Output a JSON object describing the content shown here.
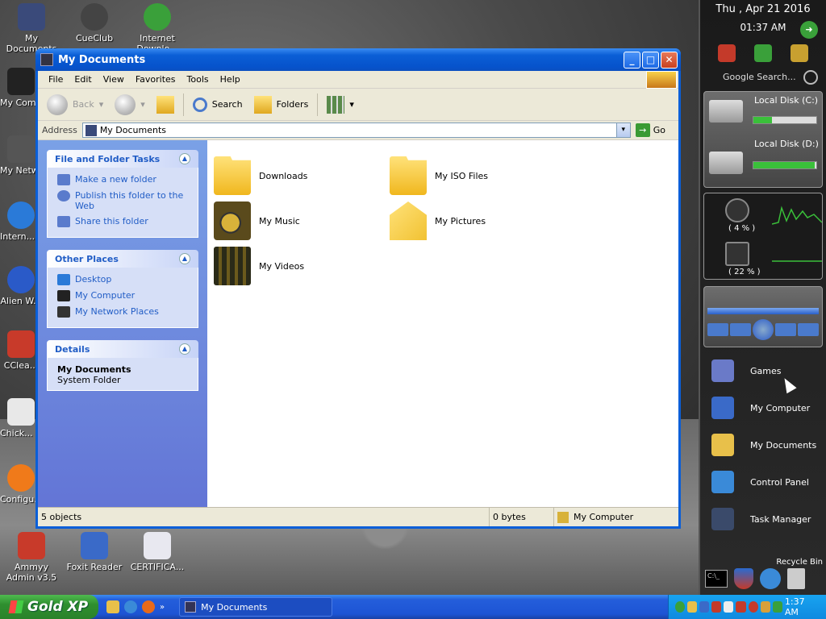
{
  "desktop": {
    "icons": [
      {
        "label": "My Documents",
        "color": "#3a4a7a"
      },
      {
        "label": "CueClub",
        "color": "#444444"
      },
      {
        "label": "Internet Downlo...",
        "color": "#3aa03a"
      },
      {
        "label": "My Com...",
        "color": "#222222"
      },
      {
        "label": "My Netw... Place...",
        "color": "#555555"
      },
      {
        "label": "Intern... Explo...",
        "color": "#2a7ad8"
      },
      {
        "label": "Alien W...",
        "color": "#2a5ac8"
      },
      {
        "label": "CClea...",
        "color": "#c83a2a"
      },
      {
        "label": "Chick... Invade...",
        "color": "#e8e8e8"
      },
      {
        "label": "Configu... Fire Scre...",
        "color": "#f07a1a"
      },
      {
        "label": "Ammyy Admin v3.5",
        "color": "#c83a2a"
      },
      {
        "label": "Foxit Reader",
        "color": "#3a6ac8"
      },
      {
        "label": "CERTIFICA...",
        "color": "#e8e8f0"
      }
    ]
  },
  "window": {
    "title": "My Documents",
    "controls": {
      "minimize": "_",
      "maximize": "□",
      "close": "✕"
    },
    "menu": [
      "File",
      "Edit",
      "View",
      "Favorites",
      "Tools",
      "Help"
    ],
    "toolbar": {
      "back": "Back",
      "search": "Search",
      "folders": "Folders"
    },
    "address": {
      "label": "Address",
      "value": "My Documents",
      "go": "Go",
      "go_arrow": "→",
      "dropdown": "▾"
    },
    "tasks_panel": {
      "title": "File and Folder Tasks",
      "items": [
        "Make a new folder",
        "Publish this folder to the Web",
        "Share this folder"
      ]
    },
    "places_panel": {
      "title": "Other Places",
      "items": [
        "Desktop",
        "My Computer",
        "My Network Places"
      ]
    },
    "details_panel": {
      "title": "Details",
      "name": "My Documents",
      "type": "System Folder"
    },
    "files": [
      {
        "name": "Downloads",
        "icon": "folder-icon"
      },
      {
        "name": "My ISO Files",
        "icon": "folder-icon"
      },
      {
        "name": "My Music",
        "icon": "music-folder-icon"
      },
      {
        "name": "My Pictures",
        "icon": "pictures-folder-icon"
      },
      {
        "name": "My Videos",
        "icon": "videos-folder-icon"
      }
    ],
    "status": {
      "objects": "5 objects",
      "size": "0 bytes",
      "location": "My Computer"
    }
  },
  "sidebar": {
    "date": "Thu , Apr 21 2016",
    "time": "01:37 AM",
    "search_placeholder": "Google Search...",
    "disks": [
      {
        "label": "Local Disk (C:)",
        "fill": 0.3
      },
      {
        "label": "Local Disk (D:)",
        "fill": 0.97
      }
    ],
    "cpu": "( 4 % )",
    "ram": "( 22 % )",
    "launcher": [
      "Games",
      "My Computer",
      "My Documents",
      "Control Panel",
      "Task Manager"
    ],
    "recycle": "Recycle Bin"
  },
  "taskbar": {
    "start": "Gold XP",
    "task": "My Documents",
    "clock": "1:37 AM"
  }
}
